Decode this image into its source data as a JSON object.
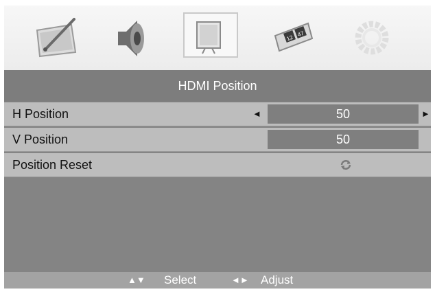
{
  "menu": {
    "tabs": [
      {
        "icon": "picture-icon",
        "selected": false
      },
      {
        "icon": "speaker-icon",
        "selected": false
      },
      {
        "icon": "display-icon",
        "selected": true
      },
      {
        "icon": "channel-icon",
        "selected": false,
        "icon_text": [
          "12",
          "47"
        ]
      },
      {
        "icon": "gear-icon",
        "selected": false
      }
    ],
    "title": "HDMI Position",
    "rows": [
      {
        "label": "H Position",
        "value": "50",
        "left_arrow": "◄",
        "right_arrow": "►"
      },
      {
        "label": "V Position",
        "value": "50"
      },
      {
        "label": "Position Reset",
        "icon": "reset-icon"
      }
    ]
  },
  "footer": {
    "select_arrows": "▲▼",
    "select_label": "Select",
    "adjust_arrows": "◄►",
    "adjust_label": "Adjust"
  },
  "colors": {
    "title_bar": "#7d7d7d",
    "row_bg": "#bdbdbd",
    "value_box": "#7f7f7f",
    "footer_bg": "#a3a3a3"
  }
}
